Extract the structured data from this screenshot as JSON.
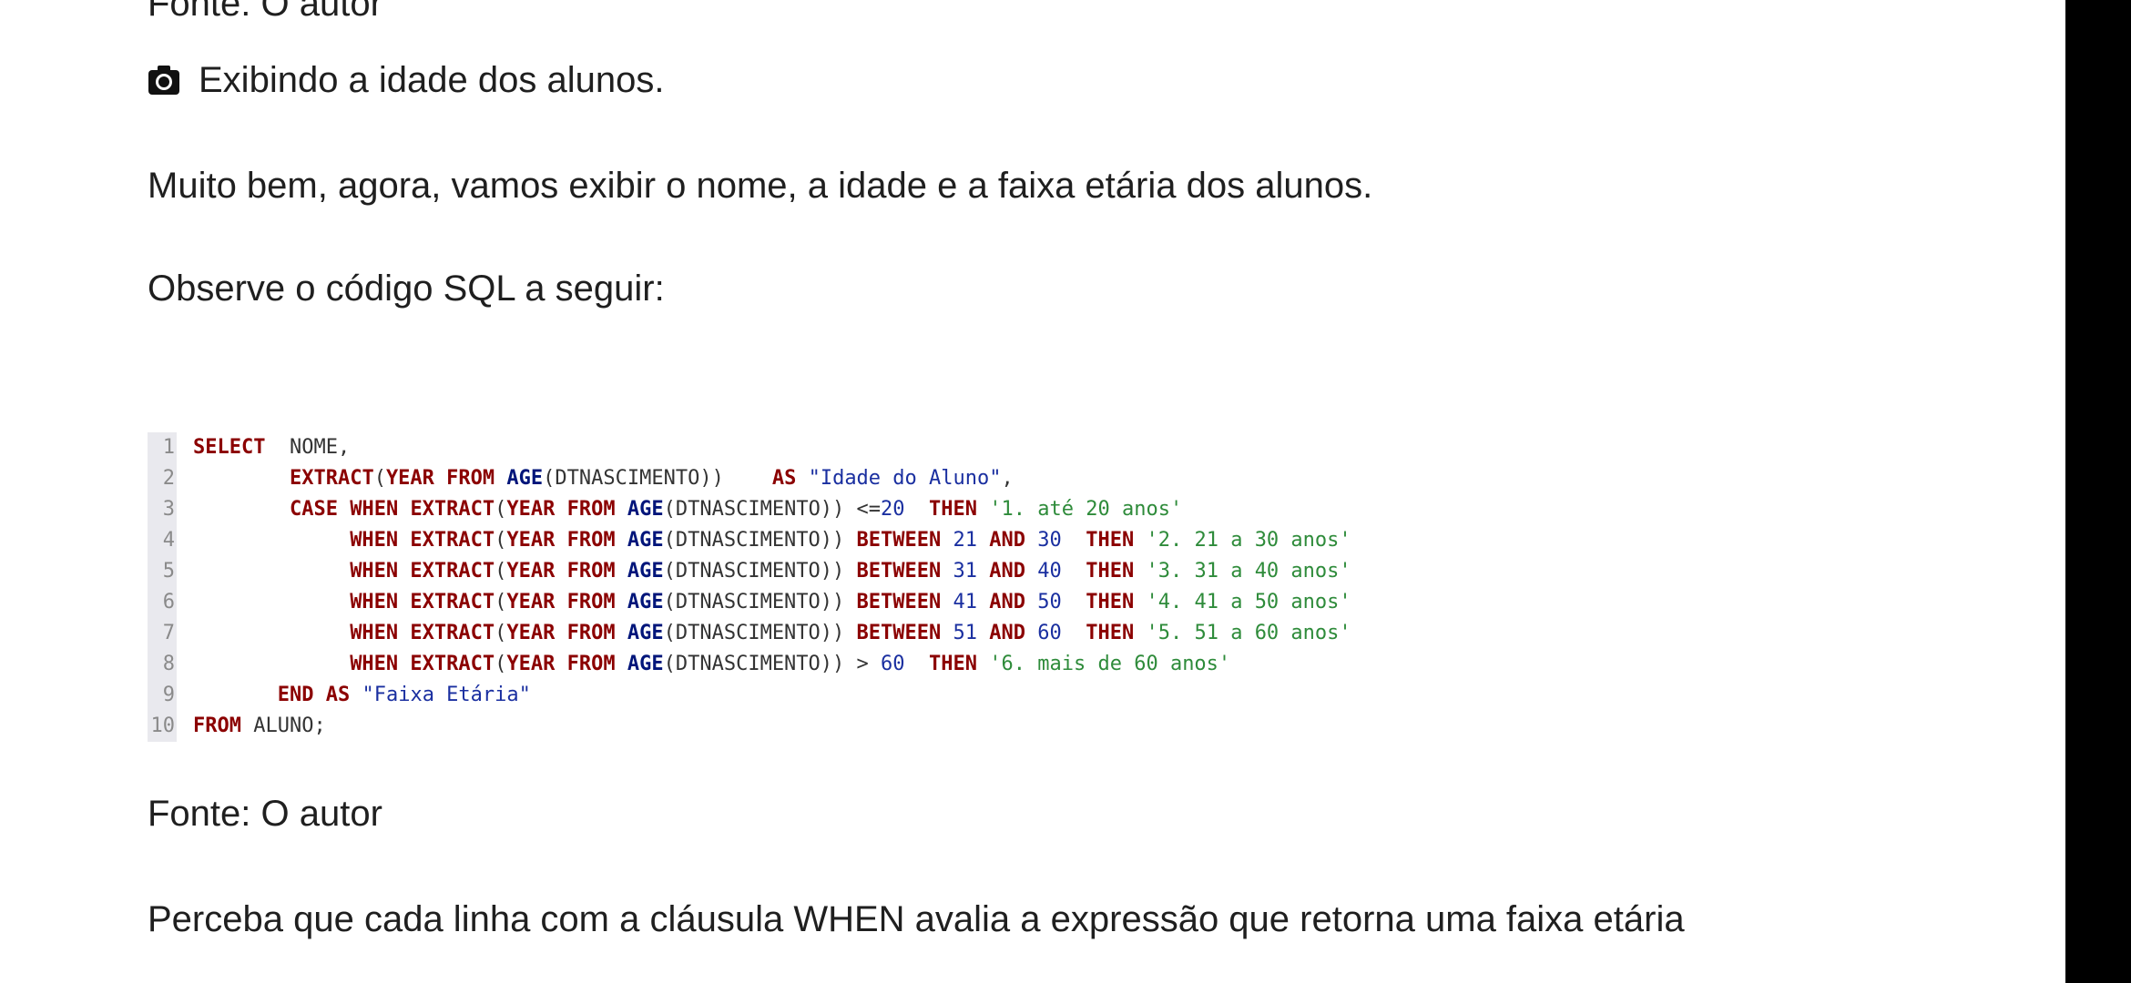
{
  "top_caption": "Fonte: O autor",
  "figure_caption": "Exibindo a idade dos alunos.",
  "para1": "Muito bem, agora, vamos exibir o nome, a idade e a faixa etária dos alunos.",
  "para2": "Observe o código SQL a seguir:",
  "code_lines": [
    {
      "num": "1",
      "segments": [
        {
          "t": "SELECT",
          "c": "kw"
        },
        {
          "t": "  NOME,",
          "c": ""
        }
      ]
    },
    {
      "num": "2",
      "segments": [
        {
          "t": "        ",
          "c": ""
        },
        {
          "t": "EXTRACT",
          "c": "kw"
        },
        {
          "t": "(",
          "c": ""
        },
        {
          "t": "YEAR",
          "c": "kw"
        },
        {
          "t": " ",
          "c": ""
        },
        {
          "t": "FROM",
          "c": "kw"
        },
        {
          "t": " ",
          "c": ""
        },
        {
          "t": "AGE",
          "c": "fn"
        },
        {
          "t": "(DTNASCIMENTO))    ",
          "c": ""
        },
        {
          "t": "AS",
          "c": "kw"
        },
        {
          "t": " ",
          "c": ""
        },
        {
          "t": "\"Idade do Aluno\"",
          "c": "qid"
        },
        {
          "t": ",",
          "c": ""
        }
      ]
    },
    {
      "num": "3",
      "segments": [
        {
          "t": "        ",
          "c": ""
        },
        {
          "t": "CASE",
          "c": "kw"
        },
        {
          "t": " ",
          "c": ""
        },
        {
          "t": "WHEN",
          "c": "kw"
        },
        {
          "t": " ",
          "c": ""
        },
        {
          "t": "EXTRACT",
          "c": "kw"
        },
        {
          "t": "(",
          "c": ""
        },
        {
          "t": "YEAR",
          "c": "kw"
        },
        {
          "t": " ",
          "c": ""
        },
        {
          "t": "FROM",
          "c": "kw"
        },
        {
          "t": " ",
          "c": ""
        },
        {
          "t": "AGE",
          "c": "fn"
        },
        {
          "t": "(DTNASCIMENTO)) <=",
          "c": ""
        },
        {
          "t": "20",
          "c": "num"
        },
        {
          "t": "  ",
          "c": ""
        },
        {
          "t": "THEN",
          "c": "kw"
        },
        {
          "t": " ",
          "c": ""
        },
        {
          "t": "'1. até 20 anos'",
          "c": "str"
        }
      ]
    },
    {
      "num": "4",
      "segments": [
        {
          "t": "             ",
          "c": ""
        },
        {
          "t": "WHEN",
          "c": "kw"
        },
        {
          "t": " ",
          "c": ""
        },
        {
          "t": "EXTRACT",
          "c": "kw"
        },
        {
          "t": "(",
          "c": ""
        },
        {
          "t": "YEAR",
          "c": "kw"
        },
        {
          "t": " ",
          "c": ""
        },
        {
          "t": "FROM",
          "c": "kw"
        },
        {
          "t": " ",
          "c": ""
        },
        {
          "t": "AGE",
          "c": "fn"
        },
        {
          "t": "(DTNASCIMENTO)) ",
          "c": ""
        },
        {
          "t": "BETWEEN",
          "c": "kw"
        },
        {
          "t": " ",
          "c": ""
        },
        {
          "t": "21",
          "c": "num"
        },
        {
          "t": " ",
          "c": ""
        },
        {
          "t": "AND",
          "c": "kw"
        },
        {
          "t": " ",
          "c": ""
        },
        {
          "t": "30",
          "c": "num"
        },
        {
          "t": "  ",
          "c": ""
        },
        {
          "t": "THEN",
          "c": "kw"
        },
        {
          "t": " ",
          "c": ""
        },
        {
          "t": "'2. 21 a 30 anos'",
          "c": "str"
        }
      ]
    },
    {
      "num": "5",
      "segments": [
        {
          "t": "             ",
          "c": ""
        },
        {
          "t": "WHEN",
          "c": "kw"
        },
        {
          "t": " ",
          "c": ""
        },
        {
          "t": "EXTRACT",
          "c": "kw"
        },
        {
          "t": "(",
          "c": ""
        },
        {
          "t": "YEAR",
          "c": "kw"
        },
        {
          "t": " ",
          "c": ""
        },
        {
          "t": "FROM",
          "c": "kw"
        },
        {
          "t": " ",
          "c": ""
        },
        {
          "t": "AGE",
          "c": "fn"
        },
        {
          "t": "(DTNASCIMENTO)) ",
          "c": ""
        },
        {
          "t": "BETWEEN",
          "c": "kw"
        },
        {
          "t": " ",
          "c": ""
        },
        {
          "t": "31",
          "c": "num"
        },
        {
          "t": " ",
          "c": ""
        },
        {
          "t": "AND",
          "c": "kw"
        },
        {
          "t": " ",
          "c": ""
        },
        {
          "t": "40",
          "c": "num"
        },
        {
          "t": "  ",
          "c": ""
        },
        {
          "t": "THEN",
          "c": "kw"
        },
        {
          "t": " ",
          "c": ""
        },
        {
          "t": "'3. 31 a 40 anos'",
          "c": "str"
        }
      ]
    },
    {
      "num": "6",
      "segments": [
        {
          "t": "             ",
          "c": ""
        },
        {
          "t": "WHEN",
          "c": "kw"
        },
        {
          "t": " ",
          "c": ""
        },
        {
          "t": "EXTRACT",
          "c": "kw"
        },
        {
          "t": "(",
          "c": ""
        },
        {
          "t": "YEAR",
          "c": "kw"
        },
        {
          "t": " ",
          "c": ""
        },
        {
          "t": "FROM",
          "c": "kw"
        },
        {
          "t": " ",
          "c": ""
        },
        {
          "t": "AGE",
          "c": "fn"
        },
        {
          "t": "(DTNASCIMENTO)) ",
          "c": ""
        },
        {
          "t": "BETWEEN",
          "c": "kw"
        },
        {
          "t": " ",
          "c": ""
        },
        {
          "t": "41",
          "c": "num"
        },
        {
          "t": " ",
          "c": ""
        },
        {
          "t": "AND",
          "c": "kw"
        },
        {
          "t": " ",
          "c": ""
        },
        {
          "t": "50",
          "c": "num"
        },
        {
          "t": "  ",
          "c": ""
        },
        {
          "t": "THEN",
          "c": "kw"
        },
        {
          "t": " ",
          "c": ""
        },
        {
          "t": "'4. 41 a 50 anos'",
          "c": "str"
        }
      ]
    },
    {
      "num": "7",
      "segments": [
        {
          "t": "             ",
          "c": ""
        },
        {
          "t": "WHEN",
          "c": "kw"
        },
        {
          "t": " ",
          "c": ""
        },
        {
          "t": "EXTRACT",
          "c": "kw"
        },
        {
          "t": "(",
          "c": ""
        },
        {
          "t": "YEAR",
          "c": "kw"
        },
        {
          "t": " ",
          "c": ""
        },
        {
          "t": "FROM",
          "c": "kw"
        },
        {
          "t": " ",
          "c": ""
        },
        {
          "t": "AGE",
          "c": "fn"
        },
        {
          "t": "(DTNASCIMENTO)) ",
          "c": ""
        },
        {
          "t": "BETWEEN",
          "c": "kw"
        },
        {
          "t": " ",
          "c": ""
        },
        {
          "t": "51",
          "c": "num"
        },
        {
          "t": " ",
          "c": ""
        },
        {
          "t": "AND",
          "c": "kw"
        },
        {
          "t": " ",
          "c": ""
        },
        {
          "t": "60",
          "c": "num"
        },
        {
          "t": "  ",
          "c": ""
        },
        {
          "t": "THEN",
          "c": "kw"
        },
        {
          "t": " ",
          "c": ""
        },
        {
          "t": "'5. 51 a 60 anos'",
          "c": "str"
        }
      ]
    },
    {
      "num": "8",
      "segments": [
        {
          "t": "             ",
          "c": ""
        },
        {
          "t": "WHEN",
          "c": "kw"
        },
        {
          "t": " ",
          "c": ""
        },
        {
          "t": "EXTRACT",
          "c": "kw"
        },
        {
          "t": "(",
          "c": ""
        },
        {
          "t": "YEAR",
          "c": "kw"
        },
        {
          "t": " ",
          "c": ""
        },
        {
          "t": "FROM",
          "c": "kw"
        },
        {
          "t": " ",
          "c": ""
        },
        {
          "t": "AGE",
          "c": "fn"
        },
        {
          "t": "(DTNASCIMENTO)) > ",
          "c": ""
        },
        {
          "t": "60",
          "c": "num"
        },
        {
          "t": "  ",
          "c": ""
        },
        {
          "t": "THEN",
          "c": "kw"
        },
        {
          "t": " ",
          "c": ""
        },
        {
          "t": "'6. mais de 60 anos'",
          "c": "str"
        }
      ]
    },
    {
      "num": "9",
      "segments": [
        {
          "t": "       ",
          "c": ""
        },
        {
          "t": "END",
          "c": "kw"
        },
        {
          "t": " ",
          "c": ""
        },
        {
          "t": "AS",
          "c": "kw"
        },
        {
          "t": " ",
          "c": ""
        },
        {
          "t": "\"Faixa Etária\"",
          "c": "qid"
        }
      ]
    },
    {
      "num": "10",
      "segments": [
        {
          "t": "FROM",
          "c": "kw"
        },
        {
          "t": " ALUNO;",
          "c": ""
        }
      ]
    }
  ],
  "code_caption": "Fonte: O autor",
  "para3": "Perceba que cada linha com a cláusula WHEN avalia a expressão que retorna uma faixa etária",
  "colors": {
    "keyword": "#8b0000",
    "function": "#00157a",
    "number": "#1a2fa0",
    "string": "#2e8b3a",
    "gutter": "#e9e9ee"
  },
  "icons": {
    "figure_icon": "camera-icon"
  }
}
